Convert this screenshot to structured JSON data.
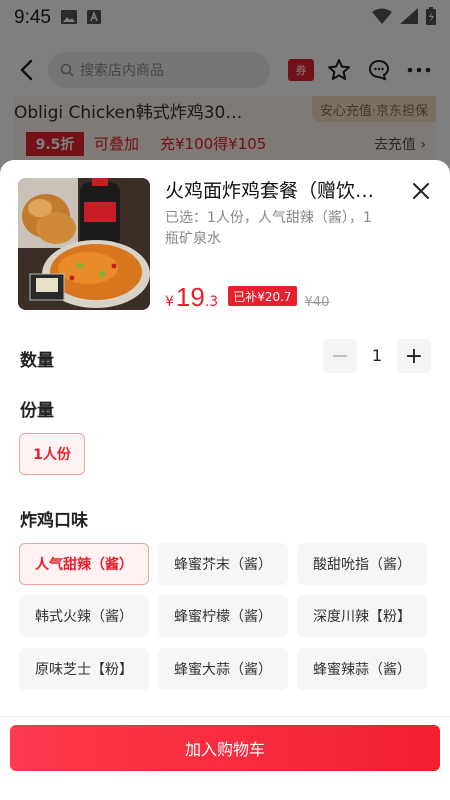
{
  "status_bar": {
    "time": "9:45"
  },
  "header": {
    "search_placeholder": "搜索店内商品",
    "store_badge": "券"
  },
  "promo": {
    "store_name": "Obligi Chicken韩式炸鸡30…",
    "safe_badge": "安心充值·京东担保",
    "discount": "9.5折",
    "stackable": "可叠加",
    "offer": "充¥100得¥105",
    "recharge_link": "去充值"
  },
  "product": {
    "title": "火鸡面炸鸡套餐（赠饮…",
    "selected_text": "已选：1人份，人气甜辣（酱），1瓶矿泉水",
    "image_stamp": "韩国炸鸡",
    "price_symbol": "¥",
    "price_int": "19",
    "price_dec": ".3",
    "subsidy": "已补¥20.7",
    "original_price": "¥40"
  },
  "quantity": {
    "label": "数量",
    "minus": "−",
    "value": "1",
    "plus": "+"
  },
  "portion": {
    "label": "份量",
    "options": [
      "1人份"
    ]
  },
  "flavor": {
    "label": "炸鸡口味",
    "options": [
      "人气甜辣（酱）",
      "蜂蜜芥末（酱）",
      "酸甜吮指（酱）",
      "韩式火辣（酱）",
      "蜂蜜柠檬（酱）",
      "深度川辣【粉】",
      "原味芝士【粉】",
      "蜂蜜大蒜（酱）",
      "蜂蜜辣蒜（酱）"
    ]
  },
  "cta": {
    "add_to_cart": "加入购物车"
  },
  "colors": {
    "accent": "#e8202e",
    "option_bg": "#f5f6f8",
    "selected_bg": "#fff2f3"
  }
}
